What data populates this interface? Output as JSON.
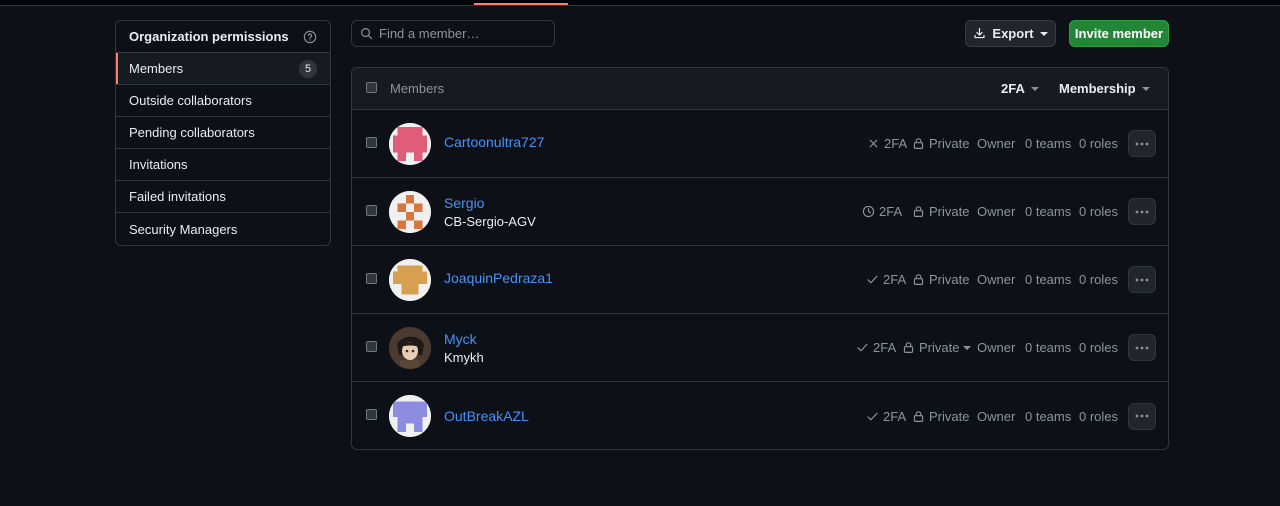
{
  "sidebar": {
    "title": "Organization permissions",
    "items": [
      {
        "label": "Members",
        "count": "5"
      },
      {
        "label": "Outside collaborators"
      },
      {
        "label": "Pending collaborators"
      },
      {
        "label": "Invitations"
      },
      {
        "label": "Failed invitations"
      },
      {
        "label": "Security Managers"
      }
    ]
  },
  "search": {
    "placeholder": "Find a member…"
  },
  "toolbar": {
    "export_label": "Export",
    "invite_label": "Invite member"
  },
  "table": {
    "header_label": "Members",
    "filter_2fa": "2FA",
    "filter_membership": "Membership",
    "rows": [
      {
        "login": "Cartoonultra727",
        "fullname": "",
        "twofa_status": "disabled",
        "twofa": "2FA",
        "visibility": "Private",
        "role": "Owner",
        "teams": "0 teams",
        "roles": "0 roles",
        "avatar_color": "#e05d7a"
      },
      {
        "login": "Sergio",
        "fullname": "CB-Sergio-AGV",
        "twofa_status": "pending",
        "twofa": "2FA",
        "visibility": "Private",
        "role": "Owner",
        "teams": "0 teams",
        "roles": "0 roles",
        "avatar_color": "#d9753f"
      },
      {
        "login": "JoaquinPedraza1",
        "fullname": "",
        "twofa_status": "enabled",
        "twofa": "2FA",
        "visibility": "Private",
        "role": "Owner",
        "teams": "0 teams",
        "roles": "0 roles",
        "avatar_color": "#d6a04f"
      },
      {
        "login": "Myck",
        "fullname": "Kmykh",
        "twofa_status": "enabled",
        "twofa": "2FA",
        "visibility": "Private",
        "role": "Owner",
        "teams": "0 teams",
        "roles": "0 roles",
        "avatar_color": "#3a2a22"
      },
      {
        "login": "OutBreakAZL",
        "fullname": "",
        "twofa_status": "enabled",
        "twofa": "2FA",
        "visibility": "Private",
        "role": "Owner",
        "teams": "0 teams",
        "roles": "0 roles",
        "avatar_color": "#8c8ce0"
      }
    ]
  },
  "colors": {
    "accent": "#f78166",
    "link": "#4493f8",
    "primary_button": "#238636"
  }
}
